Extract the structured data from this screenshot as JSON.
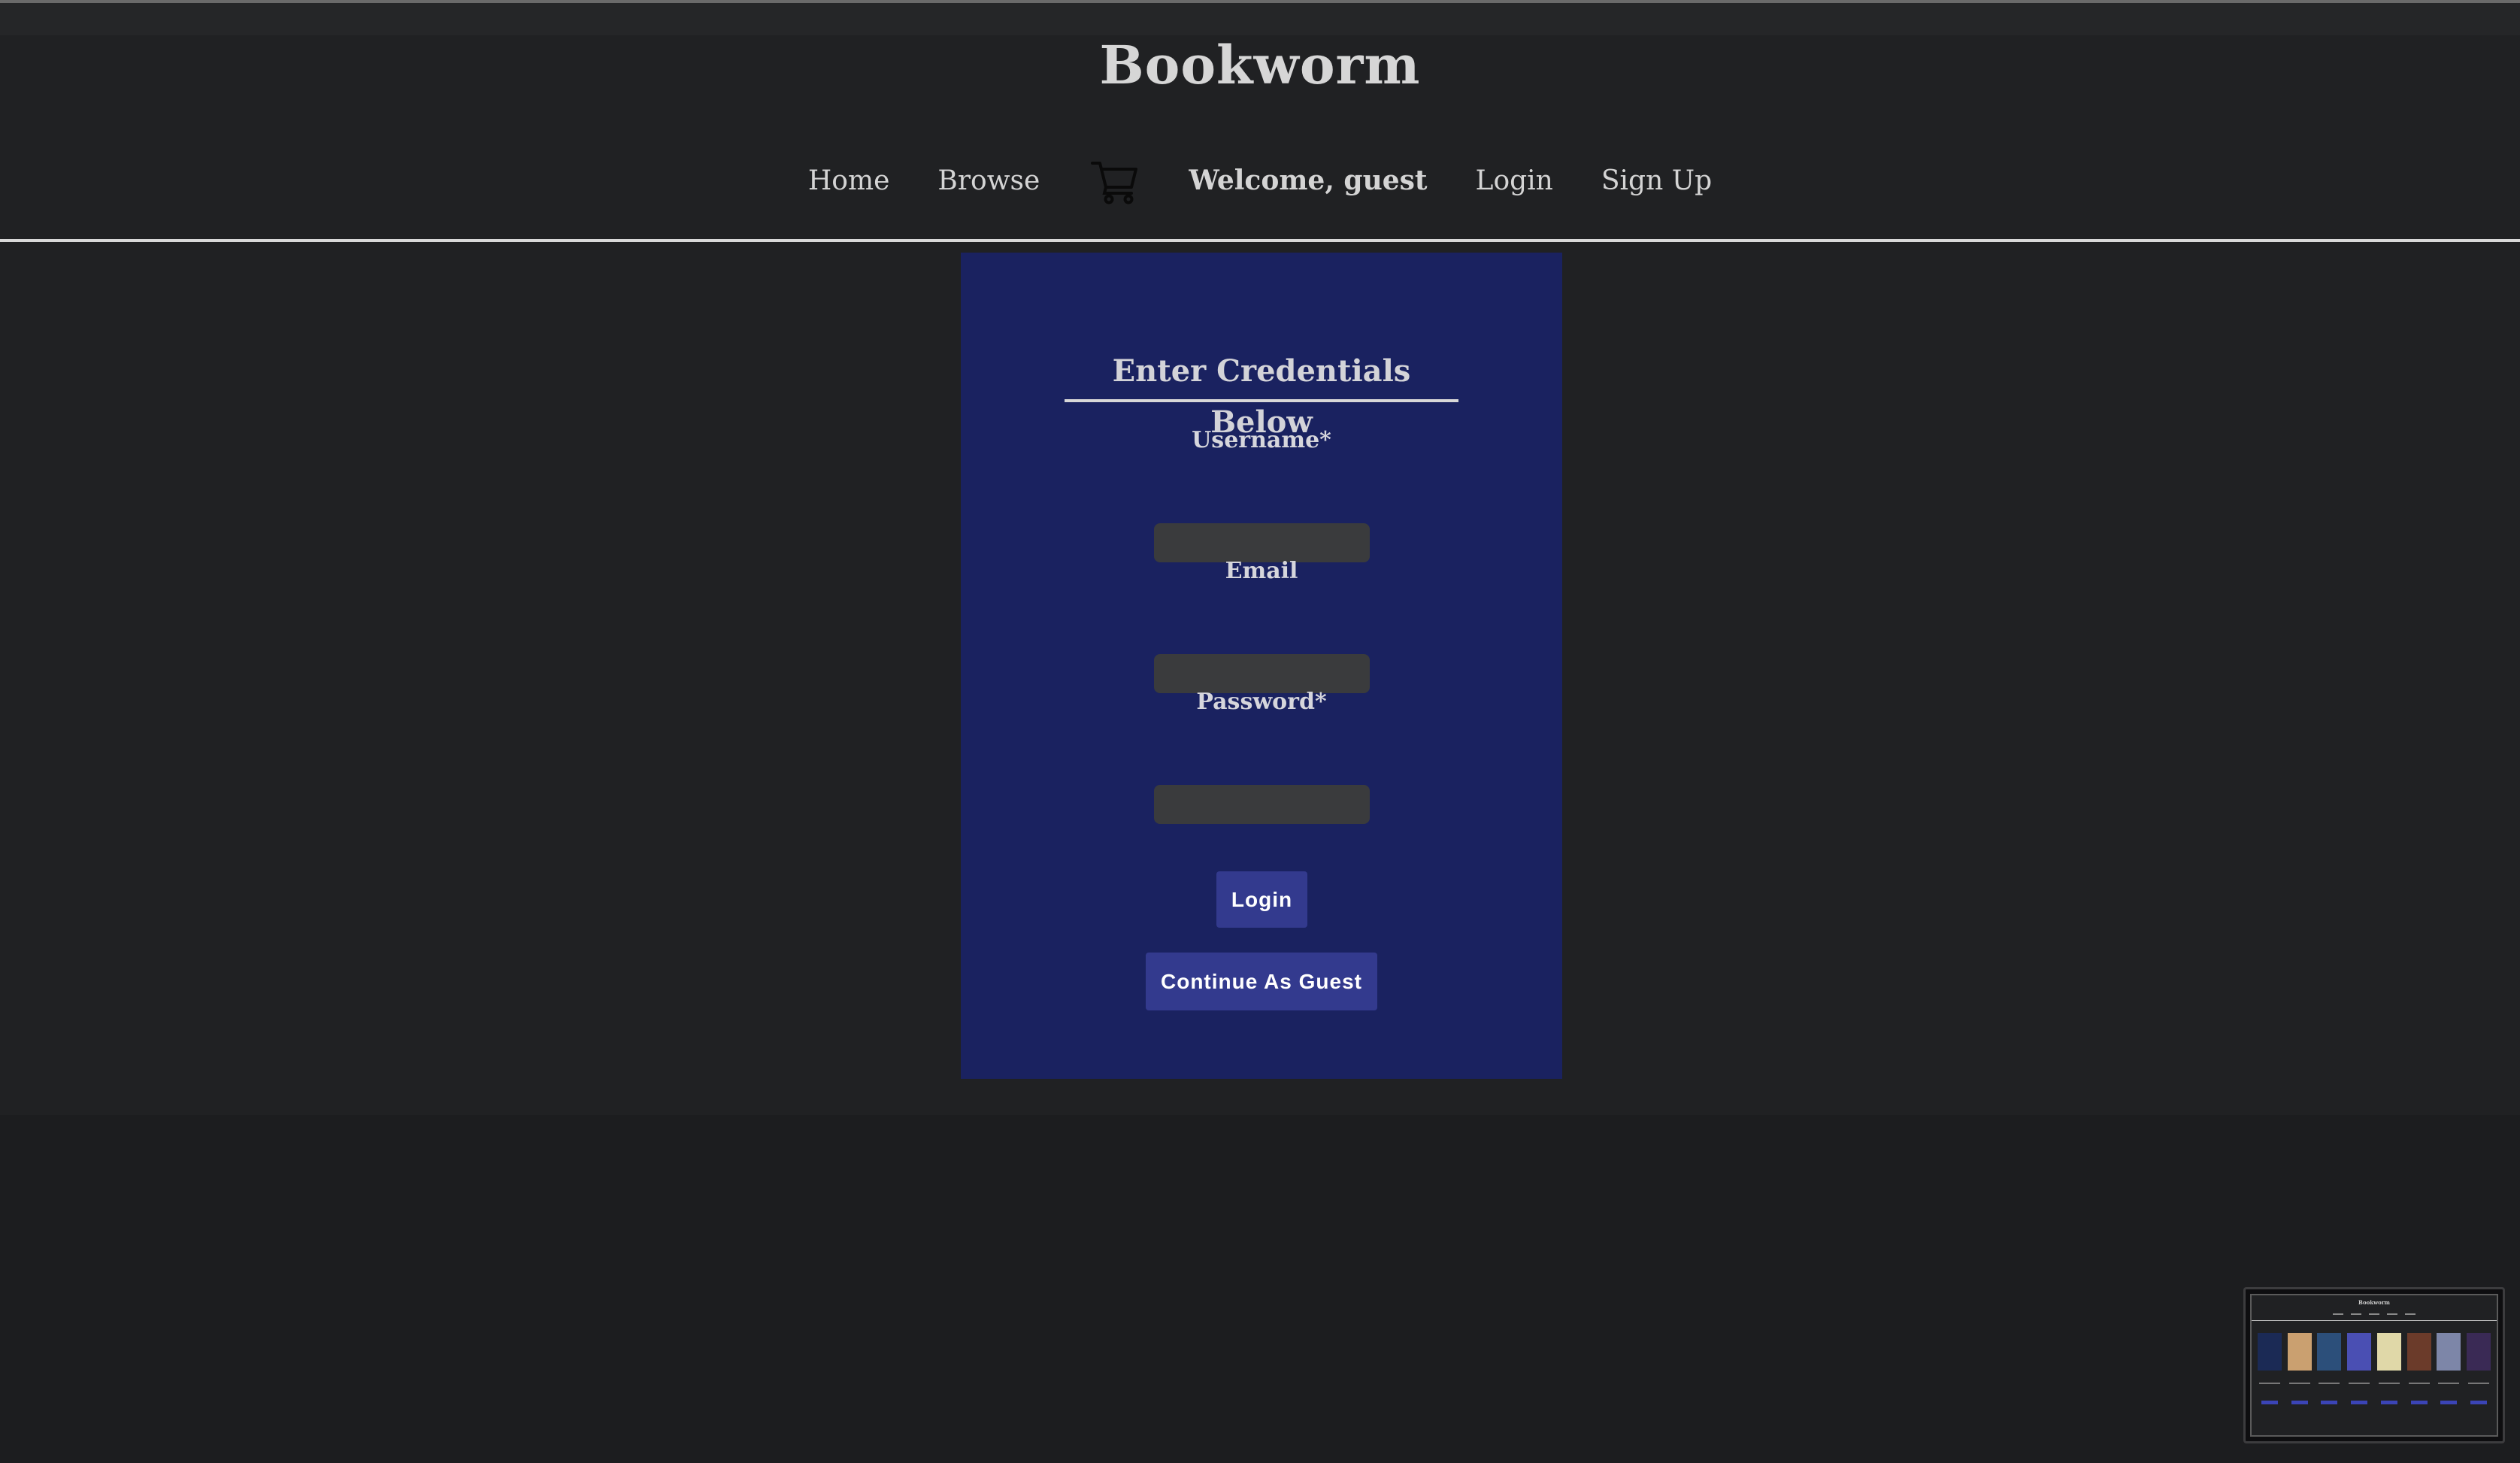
{
  "header": {
    "title": "Bookworm",
    "nav": {
      "home": "Home",
      "browse": "Browse",
      "cart_icon": "shopping-cart-icon",
      "welcome": "Welcome, guest",
      "login": "Login",
      "signup": "Sign Up"
    }
  },
  "login_form": {
    "title": "Enter Credentials Below",
    "username_label": "Username*",
    "username_value": "",
    "email_label": "Email",
    "email_value": "",
    "password_label": "Password*",
    "password_value": "",
    "login_button": "Login",
    "guest_button": "Continue As Guest"
  },
  "colors": {
    "page_background": "#202123",
    "card_background": "#1a2260",
    "button_background": "#333a8e",
    "input_background": "#3a3b3d",
    "text": "#d4d4d4"
  },
  "preview_thumbnail": {
    "title": "Bookworm",
    "book_colors": [
      "#1b2a55",
      "#caa070",
      "#2c4f7a",
      "#4a4fb3",
      "#e0d8a8",
      "#6b3b2a",
      "#7d86a8",
      "#3a2a55"
    ]
  }
}
